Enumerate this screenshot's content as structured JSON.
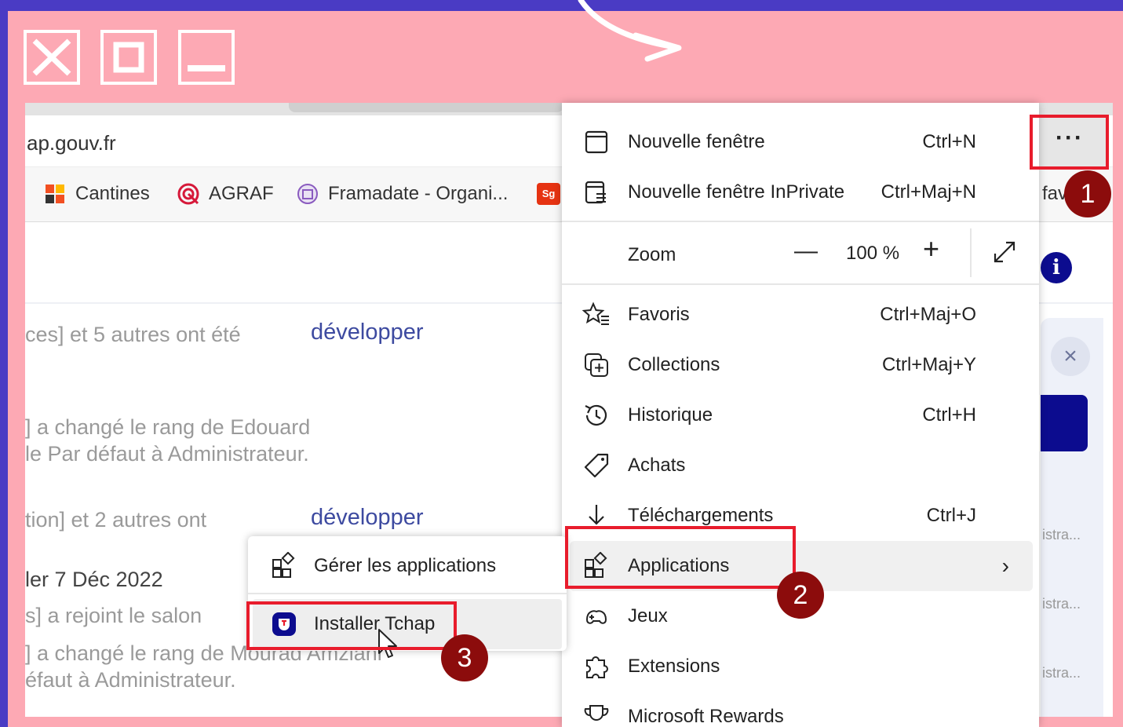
{
  "window_buttons": {
    "close_icon": "close-icon",
    "maximize_icon": "maximize-icon",
    "minimize_icon": "minimize-icon"
  },
  "browser": {
    "address": "ap.gouv.fr",
    "bookmarks": [
      {
        "label": "Cantines",
        "icon": "cantines-icon"
      },
      {
        "label": "AGRAF",
        "icon": "agraf-icon"
      },
      {
        "label": "Framadate - Organi...",
        "icon": "framadate-icon"
      }
    ],
    "bookmark_partial_icon_text": "Sg",
    "fav_partial": "fav",
    "more_button": "···"
  },
  "feed": {
    "lines": [
      "ces] et 5 autres ont été",
      "] a changé le rang de Edouard",
      "le Par défaut à Administrateur.",
      "tion] et 2 autres ont",
      "ler 7 Déc 2022",
      "s] a rejoint le salon",
      "] a changé le rang de Mourad Amziani",
      "éfaut à Administrateur."
    ],
    "develop_1": "développer",
    "develop_2": "développer"
  },
  "right_panel": {
    "info_icon": "i",
    "close": "×",
    "rows": [
      "istra...",
      "istra...",
      "istra..."
    ]
  },
  "menu": {
    "items": [
      {
        "label": "Nouvelle fenêtre",
        "shortcut": "Ctrl+N"
      },
      {
        "label": "Nouvelle fenêtre InPrivate",
        "shortcut": "Ctrl+Maj+N"
      },
      {
        "label": "Favoris",
        "shortcut": "Ctrl+Maj+O"
      },
      {
        "label": "Collections",
        "shortcut": "Ctrl+Maj+Y"
      },
      {
        "label": "Historique",
        "shortcut": "Ctrl+H"
      },
      {
        "label": "Achats",
        "shortcut": ""
      },
      {
        "label": "Téléchargements",
        "shortcut": "Ctrl+J"
      },
      {
        "label": "Applications",
        "shortcut": ""
      },
      {
        "label": "Jeux",
        "shortcut": ""
      },
      {
        "label": "Extensions",
        "shortcut": ""
      },
      {
        "label": "Microsoft Rewards",
        "shortcut": ""
      }
    ],
    "zoom": {
      "label": "Zoom",
      "minus": "—",
      "value": "100 %",
      "plus": "+"
    },
    "applications_chevron": "›"
  },
  "submenu": {
    "items": [
      {
        "label": "Gérer les applications"
      },
      {
        "label": "Installer Tchap"
      }
    ]
  },
  "badges": [
    "1",
    "2",
    "3"
  ],
  "colors": {
    "frame": "#fda9b4",
    "background": "#4a3bc4",
    "highlight": "#e81c2c",
    "badge": "#8c0c0c",
    "tchap_blue": "#0c0c8f"
  }
}
